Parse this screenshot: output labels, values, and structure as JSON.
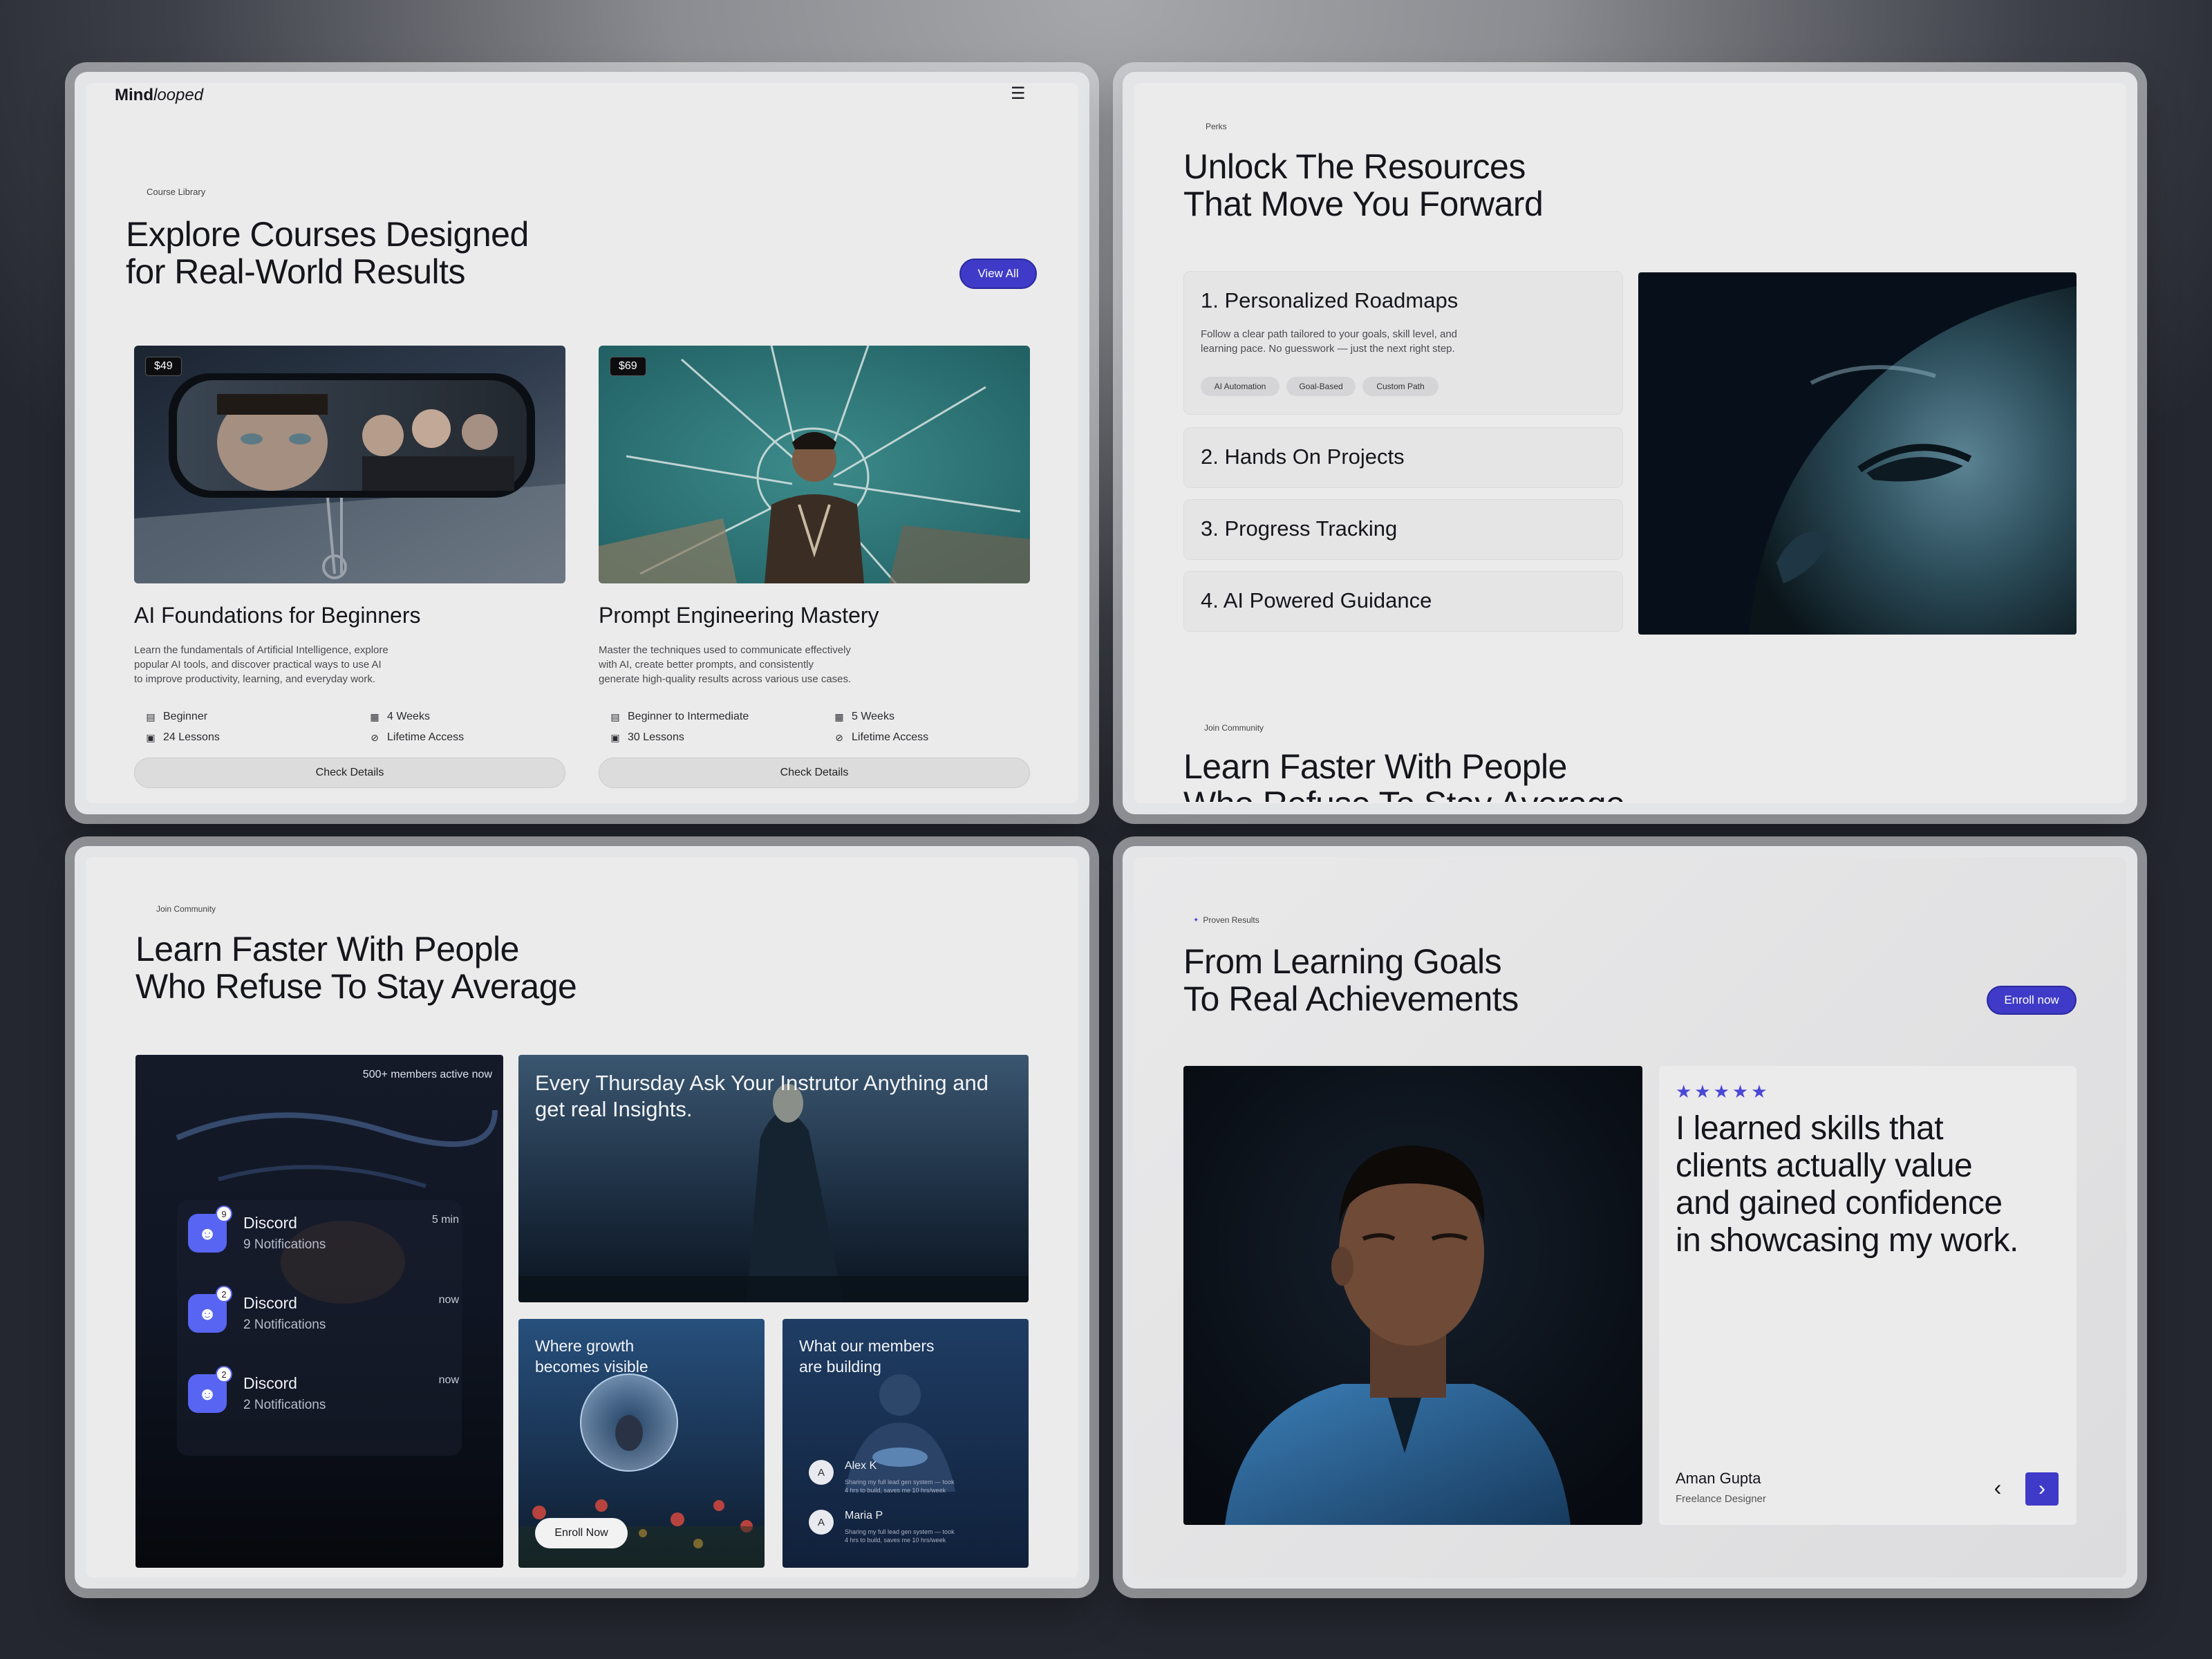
{
  "panel1": {
    "brand_main": "Mind",
    "brand_italic": "looped",
    "menu_icon": "☰",
    "eyebrow": "Course Library",
    "title_line1": "Explore Courses Designed",
    "title_line2": "for Real-World Results",
    "view_all": "View All",
    "courses": [
      {
        "price": "$49",
        "title": "AI Foundations for Beginners",
        "desc_line1": "Learn the fundamentals of Artificial Intelligence, explore",
        "desc_line2": "popular AI tools, and discover practical ways to use AI",
        "desc_line3": "to improve productivity, learning, and everyday work.",
        "level": "Beginner",
        "duration": "4 Weeks",
        "lessons": "24 Lessons",
        "access": "Lifetime Access",
        "cta": "Check Details"
      },
      {
        "price": "$69",
        "title": "Prompt Engineering Mastery",
        "desc_line1": "Master the techniques used to communicate effectively",
        "desc_line2": "with AI, create better prompts, and consistently",
        "desc_line3": "generate high-quality results across various use cases.",
        "level": "Beginner to Intermediate",
        "duration": "5 Weeks",
        "lessons": "30 Lessons",
        "access": "Lifetime Access",
        "cta": "Check Details"
      }
    ]
  },
  "panel2": {
    "eyebrow": "Perks",
    "title_line1": "Unlock The Resources",
    "title_line2": "That Move You Forward",
    "perks": [
      {
        "title": "1. Personalized Roadmaps",
        "desc_line1": "Follow a clear path tailored to your goals, skill level, and",
        "desc_line2": "learning pace. No guesswork — just the next right step.",
        "tags": [
          "AI Automation",
          "Goal-Based",
          "Custom Path"
        ]
      },
      {
        "title": "2. Hands On Projects"
      },
      {
        "title": "3. Progress Tracking"
      },
      {
        "title": "4. AI Powered Guidance"
      }
    ],
    "community_eyebrow": "Join Community",
    "community_title_line1": "Learn Faster With People",
    "community_title_line2": "Who Refuse To Stay Average"
  },
  "panel3": {
    "eyebrow": "Join Community",
    "title_line1": "Learn Faster With People",
    "title_line2": "Who Refuse To Stay Average",
    "members_active": "500+ members active now",
    "notifications": [
      {
        "badge": "9",
        "name": "Discord",
        "count": "9 Notifications",
        "time": "5 min"
      },
      {
        "badge": "2",
        "name": "Discord",
        "count": "2 Notifications",
        "time": "now"
      },
      {
        "badge": "2",
        "name": "Discord",
        "count": "2 Notifications",
        "time": "now"
      }
    ],
    "thursday_line1": "Every Thursday Ask Your Instrutor Anything and",
    "thursday_line2": "get real Insights.",
    "growth_line1": "Where growth",
    "growth_line2": "becomes visible",
    "enroll_now": "Enroll Now",
    "building_line1": "What our members",
    "building_line2": "are building",
    "members": [
      {
        "initial": "A",
        "name": "Alex K",
        "note_line1": "Sharing my full lead gen system — took",
        "note_line2": "4 hrs to build, saves me 10 hrs/week"
      },
      {
        "initial": "A",
        "name": "Maria P",
        "note_line1": "Sharing my full lead gen system — took",
        "note_line2": "4 hrs to build, saves me 10 hrs/week"
      }
    ]
  },
  "panel4": {
    "eyebrow": "Proven Results",
    "title_line1": "From Learning Goals",
    "title_line2": "To Real Achievements",
    "enroll": "Enroll now",
    "stars": "★★★★★",
    "quote_line1": "I learned skills that",
    "quote_line2": "clients actually value",
    "quote_line3": "and gained confidence",
    "quote_line4": "in showcasing my work.",
    "author": "Aman Gupta",
    "role": "Freelance Designer",
    "prev_icon": "‹",
    "next_icon": "›"
  },
  "colors": {
    "accent": "#3f3bc8",
    "discord": "#5865f2",
    "panel_bg": "#ebebeb"
  }
}
